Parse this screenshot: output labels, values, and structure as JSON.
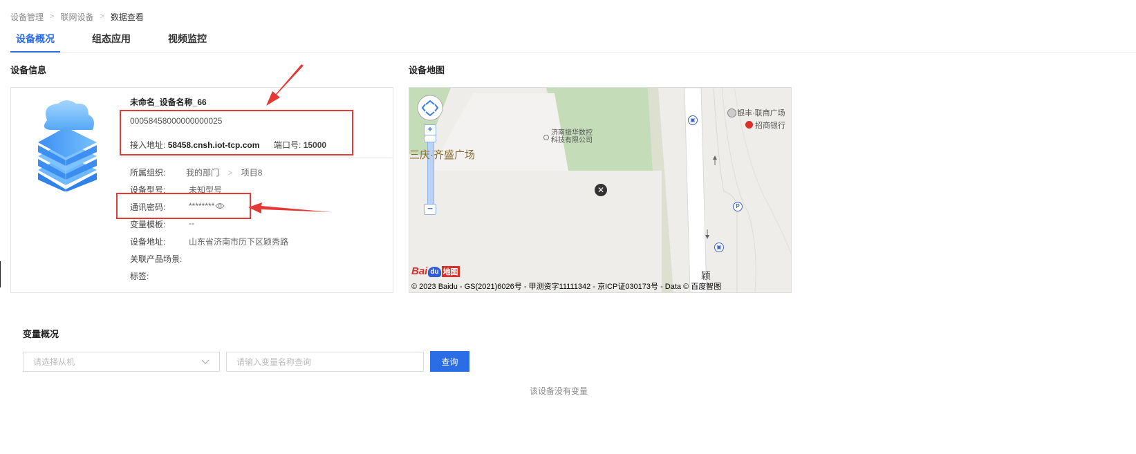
{
  "breadcrumb": [
    "设备管理",
    "联网设备",
    "数据查看"
  ],
  "tabs": [
    {
      "label": "设备概况",
      "active": true
    },
    {
      "label": "组态应用",
      "active": false
    },
    {
      "label": "视频监控",
      "active": false
    }
  ],
  "device_info": {
    "title": "设备信息",
    "name": "未命名_设备名称_66",
    "id": "00058458000000000025",
    "access_label": "接入地址:",
    "access_value": "58458.cnsh.iot-tcp.com",
    "port_label": "端口号:",
    "port_value": "15000",
    "props": {
      "org_label": "所属组织:",
      "org_parts": [
        "我的部门",
        "项目8"
      ],
      "model_label": "设备型号:",
      "model_value": "未知型号",
      "password_label": "通讯密码:",
      "password_value": "********",
      "template_label": "变量模板:",
      "template_value": "--",
      "address_label": "设备地址:",
      "address_value": "山东省济南市历下区颖秀路",
      "scene_label": "关联产品场景:",
      "tag_label": "标签:"
    }
  },
  "map": {
    "title": "设备地图",
    "poi_1": "济南振华数控",
    "poi_1b": "科技有限公司",
    "plaza": "三庆·齐盛广场",
    "poi_2": "银丰·联商广场",
    "poi_3": "招商银行",
    "road": "颖",
    "logo_bai": "Bai",
    "logo_du": "du",
    "logo_map": "地图",
    "copyright": "© 2023 Baidu - GS(2021)6026号 - 甲测资字11111342 - 京ICP证030173号 - Data © 百度智图"
  },
  "variables": {
    "title": "变量概况",
    "select_placeholder": "请选择从机",
    "search_placeholder": "请输入变量名称查询",
    "query_label": "查询",
    "empty_text": "该设备没有变量"
  },
  "colors": {
    "accent": "#2b6de5",
    "annotation_red": "#e53935"
  },
  "icons": [
    "chevron-right-icon",
    "eye-icon",
    "cloud-server-icon",
    "chevron-down-icon",
    "pan-control-icon",
    "zoom-in-icon",
    "zoom-out-icon",
    "close-icon",
    "bus-stop-icon",
    "parking-icon",
    "bank-icon",
    "shop-icon"
  ]
}
